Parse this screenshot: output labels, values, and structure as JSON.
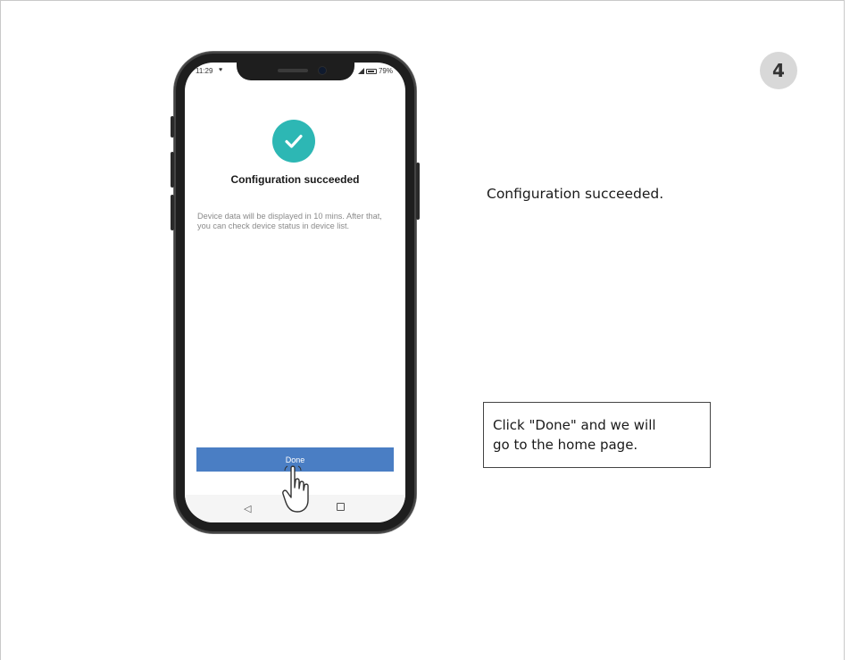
{
  "step": {
    "number": "4"
  },
  "phone": {
    "status_bar": {
      "time": "11:29",
      "battery": "79%"
    },
    "result": {
      "title": "Configuration succeeded",
      "description": "Device data will be displayed in 10 mins. After that, you can check device status in device list."
    },
    "done_button_label": "Done",
    "nav": {
      "back_icon": "triangle-back-icon",
      "home_icon": "circle-home-icon",
      "recent_icon": "square-recent-icon"
    }
  },
  "instructions": {
    "main": "Configuration succeeded.",
    "note_line1": "Click \"Done\" and we will",
    "note_line2": "go to the home page."
  },
  "colors": {
    "accent_teal": "#2db7b4",
    "button_blue": "#4a7ec4",
    "badge_gray": "#d8d8d8"
  }
}
